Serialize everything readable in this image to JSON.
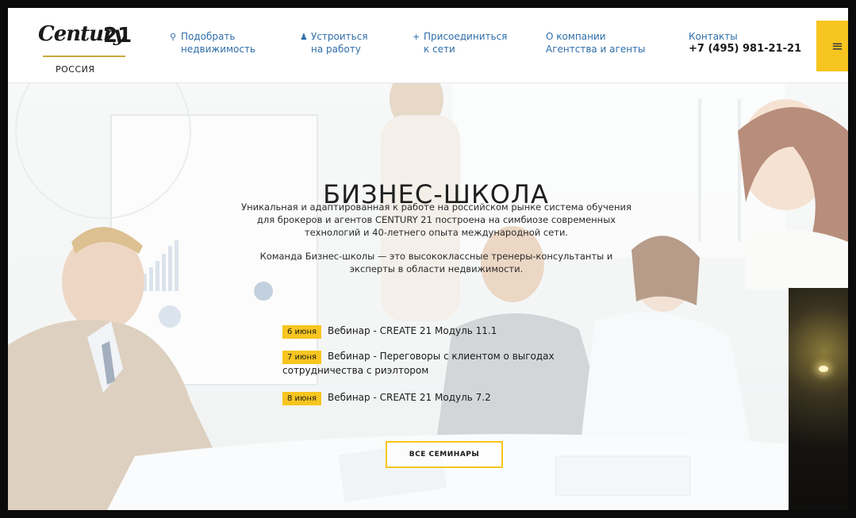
{
  "header": {
    "logo": {
      "word": "Century",
      "number": "21",
      "country": "РОССИЯ"
    },
    "nav": [
      {
        "icon": "search-icon",
        "line1": "Подобрать",
        "line2": "недвижимость"
      },
      {
        "icon": "person-icon",
        "line1": "Устроиться",
        "line2": "на работу"
      },
      {
        "icon": "plus-icon",
        "line1": "Присоединиться",
        "line2": "к сети"
      },
      {
        "icon": "",
        "line1": "О компании",
        "line2": "Агентства и агенты"
      }
    ],
    "contacts": {
      "label": "Контакты",
      "phone": "+7 (495) 981-21-21"
    },
    "menu_icon": "hamburger-icon"
  },
  "hero": {
    "title": "БИЗНЕС-ШКОЛА",
    "description_1": "Уникальная и адаптированная к работе на российском рынке система обучения для брокеров и агентов CENTURY 21 построена на симбиозе современных технологий и 40-летнего опыта международной сети.",
    "description_2": "Команда Бизнес-школы — это высококлассные тренеры-консультанты и эксперты в области недвижимости.",
    "events": [
      {
        "date": "6 июня",
        "text": "Вебинар - CREATE 21 Модуль 11.1"
      },
      {
        "date": "7 июня",
        "text": "Вебинар - Переговоры с клиентом о выгодах сотрудничества с риэлтором"
      },
      {
        "date": "8 июня",
        "text": "Вебинар - CREATE 21 Модуль 7.2"
      }
    ],
    "all_seminars_label": "ВСЕ СЕМИНАРЫ"
  },
  "colors": {
    "accent": "#f7c51f",
    "link": "#2f6ea8",
    "gold": "#c7a93d"
  }
}
